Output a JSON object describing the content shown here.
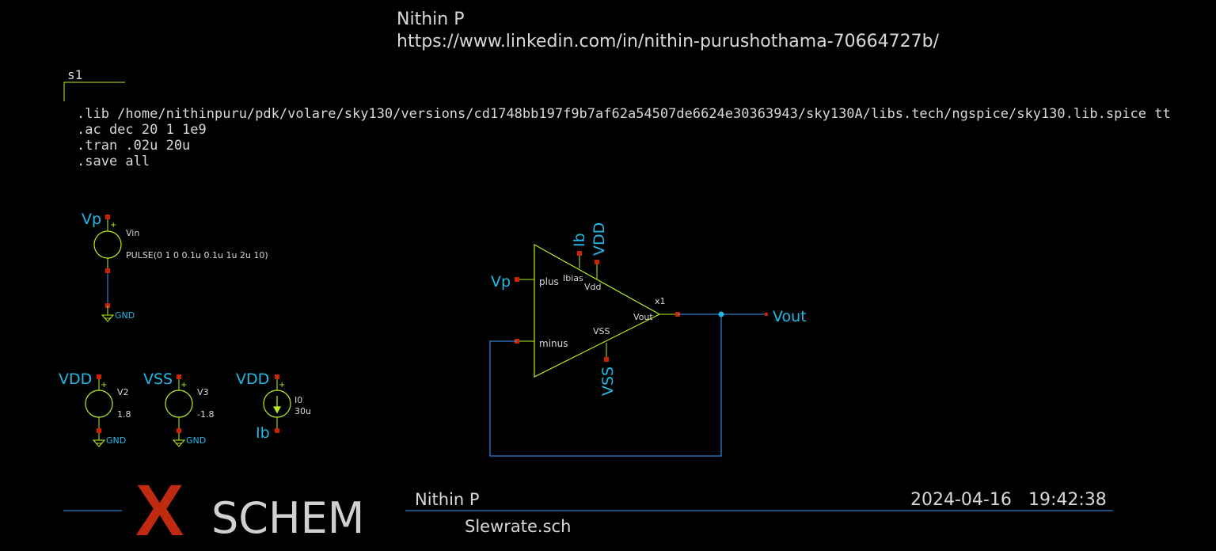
{
  "header": {
    "author": "Nithin P",
    "url": "https://www.linkedin.com/in/nithin-purushothama-70664727b/"
  },
  "code_block": {
    "name": "s1",
    "lines": [
      ".lib /home/nithinpuru/pdk/volare/sky130/versions/cd1748bb197f9b7af62a54507de6624e30363943/sky130A/libs.tech/ngspice/sky130.lib.spice tt",
      ".ac dec 20 1 1e9",
      ".tran .02u 20u",
      ".save all"
    ]
  },
  "vin": {
    "net": "Vp",
    "name": "Vin",
    "value": "PULSE(0 1 0 0.1u 0.1u 1u 2u 10)",
    "gnd": "GND"
  },
  "v2": {
    "net": "VDD",
    "name": "V2",
    "value": "1.8",
    "gnd": "GND"
  },
  "v3": {
    "net": "VSS",
    "name": "V3",
    "value": "-1.8",
    "gnd": "GND"
  },
  "i0": {
    "net_top": "VDD",
    "name": "I0",
    "value": "30u",
    "net_bottom": "Ib"
  },
  "opamp": {
    "instance": "x1",
    "pins": {
      "plus": "plus",
      "minus": "minus",
      "ibias": "Ibias",
      "vdd": "Vdd",
      "vss": "VSS",
      "vout": "Vout"
    },
    "nets": {
      "plus": "Vp",
      "ibias": "Ib",
      "vdd": "VDD",
      "vss": "VSS",
      "out": "Vout"
    }
  },
  "footer": {
    "logo_x": "X",
    "logo_text": "SCHEM",
    "author": "Nithin P",
    "date": "2024-04-16",
    "time": "19:42:38",
    "filename": "Slewrate.sch"
  },
  "colors": {
    "background": "#000000",
    "wire": "#3aa0ff",
    "net_label": "#22b8e8",
    "symbol": "#b8f020",
    "pin": "#cc2200",
    "text": "#d8d8d8",
    "logo_red": "#c02a10",
    "logo_gray": "#d0d0d0"
  }
}
